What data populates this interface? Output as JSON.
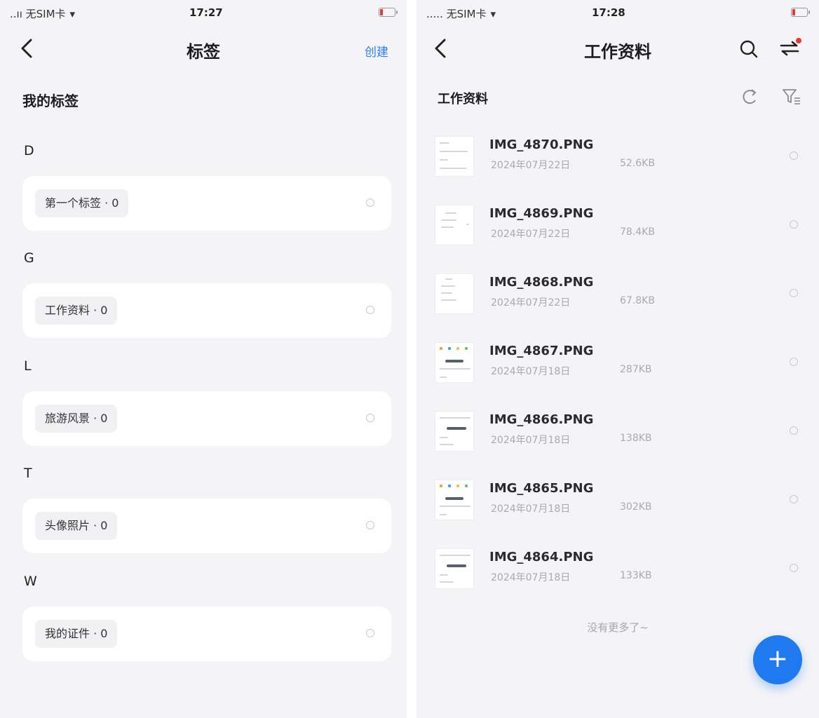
{
  "left": {
    "status": {
      "carrier": "..ıı 无SIM卡",
      "time": "17:27"
    },
    "title": "标签",
    "create": "创建",
    "section_title": "我的标签",
    "groups": [
      {
        "letter": "D",
        "tag": "第一个标签 · 0"
      },
      {
        "letter": "G",
        "tag": "工作资料 · 0"
      },
      {
        "letter": "L",
        "tag": "旅游风景 · 0"
      },
      {
        "letter": "T",
        "tag": "头像照片 · 0"
      },
      {
        "letter": "W",
        "tag": "我的证件 · 0"
      }
    ]
  },
  "right": {
    "status": {
      "carrier": "..... 无SIM卡",
      "time": "17:28"
    },
    "title": "工作资料",
    "subtitle": "工作资料",
    "files": [
      {
        "name": "IMG_4870.PNG",
        "date": "2024年07月22日",
        "size": "52.6KB"
      },
      {
        "name": "IMG_4869.PNG",
        "date": "2024年07月22日",
        "size": "78.4KB"
      },
      {
        "name": "IMG_4868.PNG",
        "date": "2024年07月22日",
        "size": "67.8KB"
      },
      {
        "name": "IMG_4867.PNG",
        "date": "2024年07月18日",
        "size": "287KB"
      },
      {
        "name": "IMG_4866.PNG",
        "date": "2024年07月18日",
        "size": "138KB"
      },
      {
        "name": "IMG_4865.PNG",
        "date": "2024年07月18日",
        "size": "302KB"
      },
      {
        "name": "IMG_4864.PNG",
        "date": "2024年07月18日",
        "size": "133KB"
      }
    ],
    "end_text": "没有更多了~",
    "fab_label": "+"
  },
  "colors": {
    "accent": "#2f7cf6",
    "fab": "#1f7af0",
    "battery_low": "#e53935",
    "notify_dot": "#e53935"
  },
  "icons": [
    "wifi-icon",
    "battery-icon",
    "back-icon",
    "search-icon",
    "sort-icon",
    "refresh-icon",
    "filter-icon",
    "plus-icon"
  ]
}
